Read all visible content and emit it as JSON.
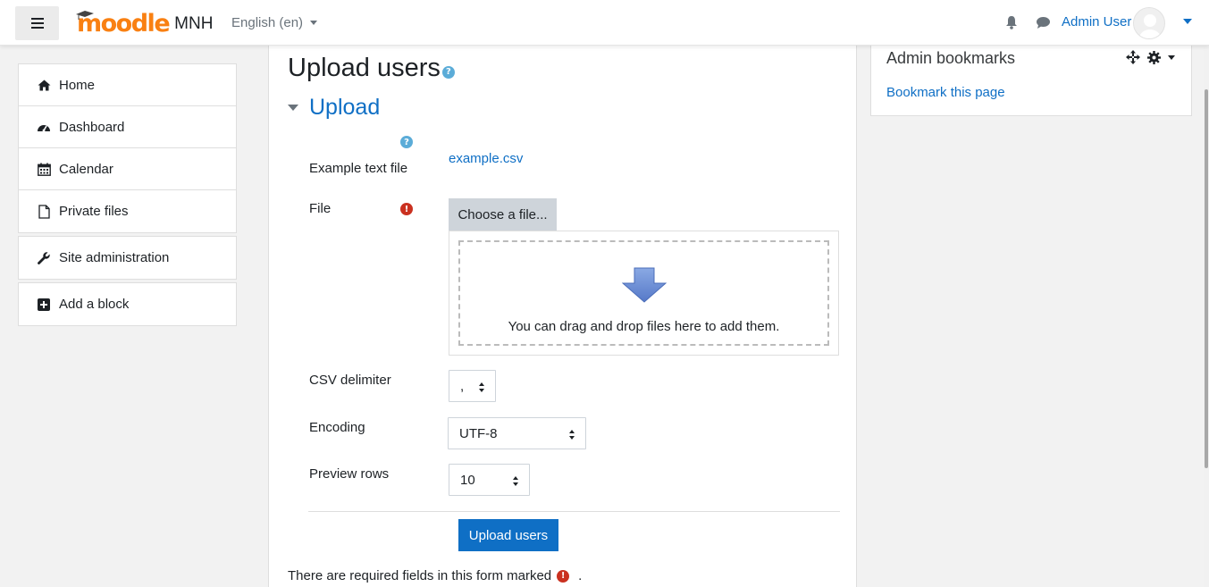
{
  "header": {
    "menu_toggle_label": "Side panel",
    "logo_text": "moodle",
    "site_name": "MNH",
    "language": "English (en)",
    "user_name": "Admin User"
  },
  "nav": {
    "items": [
      {
        "label": "Home",
        "icon": "home-icon"
      },
      {
        "label": "Dashboard",
        "icon": "dashboard-icon"
      },
      {
        "label": "Calendar",
        "icon": "calendar-icon"
      },
      {
        "label": "Private files",
        "icon": "file-icon"
      }
    ],
    "site_admin": "Site administration",
    "add_block": "Add a block"
  },
  "main": {
    "page_title": "Upload users",
    "section_title": "Upload",
    "example_label": "Example text file",
    "example_link": "example.csv",
    "file_label": "File",
    "choose_file": "Choose a file...",
    "drop_message": "You can drag and drop files here to add them.",
    "csv_delimiter_label": "CSV delimiter",
    "csv_delimiter_value": ",",
    "encoding_label": "Encoding",
    "encoding_value": "UTF-8",
    "preview_rows_label": "Preview rows",
    "preview_rows_value": "10",
    "submit_label": "Upload users",
    "required_note_prefix": "There are required fields in this form marked",
    "required_note_suffix": "."
  },
  "bookmarks_block": {
    "title": "Admin bookmarks",
    "link": "Bookmark this page"
  },
  "colors": {
    "brand_orange": "#f98012",
    "link_blue": "#0f6fc5",
    "primary_button": "#0f6fc5",
    "required_red": "#ca3120",
    "help_blue": "#5bacd8"
  }
}
